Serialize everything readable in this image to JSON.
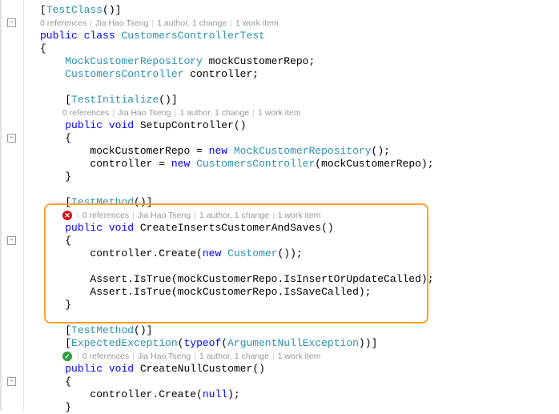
{
  "attrs": {
    "testClass": "TestClass",
    "testInitialize": "TestInitialize",
    "testMethod": "TestMethod",
    "expectedException": "ExpectedException",
    "argumentNullException": "ArgumentNullException"
  },
  "keywords": {
    "public": "public",
    "class": "class",
    "void": "void",
    "new": "new",
    "typeof": "typeof",
    "null": "null"
  },
  "types": {
    "mockCustomerRepository": "MockCustomerRepository",
    "customersController": "CustomersController",
    "customer": "Customer"
  },
  "className": "CustomersControllerTest",
  "fields": {
    "mockRepoDecl": " mockCustomerRepo;",
    "controllerDecl": " controller;"
  },
  "methods": {
    "setupController": "SetupController",
    "createInsertsCustomerAndSaves": "CreateInsertsCustomerAndSaves",
    "createNullCustomer": "CreateNullCustomer"
  },
  "body": {
    "assignRepo": "mockCustomerRepo = ",
    "assignController": "controller = ",
    "mockRepoParens": "();",
    "controllerCtorArgs": "(mockCustomerRepo);",
    "controllerCreate": "controller.Create(",
    "customerParens": "());",
    "assertIsTrueInsert": "Assert.IsTrue(mockCustomerRepo.IsInsertOrUpdateCalled);",
    "assertIsTrueSave": "Assert.IsTrue(mockCustomerRepo.IsSaveCalled);",
    "controllerCreateNull": "controller.Create(",
    "nullClose": ");"
  },
  "codelens": {
    "refs": "0 references",
    "author": "Jia Hao Tseng",
    "changes": "1 author, 1 change",
    "workitem": "1 work item",
    "sep": "|"
  },
  "punct": {
    "openBracket": "[",
    "closeBracket": "]",
    "openBrace": "{",
    "closeBrace": "}",
    "parens": "()",
    "openParen": "(",
    "closeParen": ")",
    "semi": ";",
    "closeParenBracket": "))]"
  },
  "foldGlyph": "−"
}
